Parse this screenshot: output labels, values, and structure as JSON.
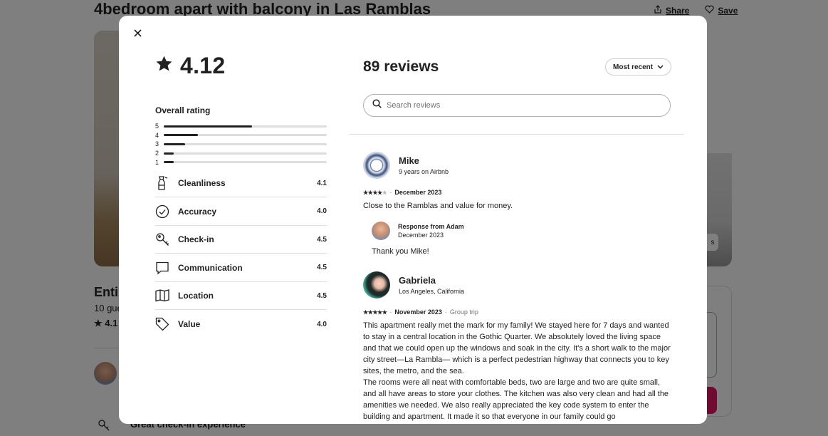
{
  "background": {
    "listing_title": "4bedroom apart with balcony in Las Ramblas",
    "share_label": "Share",
    "save_label": "Save",
    "subtitle": "Enti",
    "guests": "10 gue",
    "rating": "4.1",
    "bottom_text": "Great check-in experience"
  },
  "modal": {
    "overall_rating": "4.12",
    "overall_label": "Overall rating",
    "distribution": [
      {
        "label": "5",
        "fraction": 0.54
      },
      {
        "label": "4",
        "fraction": 0.21
      },
      {
        "label": "3",
        "fraction": 0.13
      },
      {
        "label": "2",
        "fraction": 0.06
      },
      {
        "label": "1",
        "fraction": 0.06
      }
    ],
    "categories": [
      {
        "name": "Cleanliness",
        "value": "4.1",
        "icon": "spray-bottle-icon"
      },
      {
        "name": "Accuracy",
        "value": "4.0",
        "icon": "check-circle-icon"
      },
      {
        "name": "Check-in",
        "value": "4.5",
        "icon": "key-icon"
      },
      {
        "name": "Communication",
        "value": "4.5",
        "icon": "chat-bubble-icon"
      },
      {
        "name": "Location",
        "value": "4.5",
        "icon": "map-icon"
      },
      {
        "name": "Value",
        "value": "4.0",
        "icon": "tag-icon"
      }
    ],
    "reviews_count": "89 reviews",
    "sort_label": "Most recent",
    "search_placeholder": "Search reviews",
    "reviews": [
      {
        "name": "Mike",
        "sub": "9 years on Airbnb",
        "stars": 4,
        "date": "December 2023",
        "trip": "",
        "text": "Close to the Ramblas and value for money.",
        "response": {
          "name": "Response from Adam",
          "date": "December 2023",
          "text": "Thank you Mike!"
        }
      },
      {
        "name": "Gabriela",
        "sub": "Los Angeles, California",
        "stars": 5,
        "date": "November 2023",
        "trip": "Group trip",
        "text": "This apartment really met the mark for my family! We stayed here for 7 days and wanted to stay in a central location in the Gothic Quarter. We absolutely loved the living space and that we could open up the windows and soak in the city. It's a short walk to the major city street—La Rambla— which is a perfect pedestrian highway that connects you to key sites, the metro, and the sea.",
        "text2": "The rooms were all neat with comfortable beds, two are large and two are quite small, and all have areas to store your clothes. The kitchen was also very clean and had all the amenities we needed. We also really appreciated the key code system to enter the building and apartment. It made it so that everyone in our family could go"
      }
    ]
  }
}
